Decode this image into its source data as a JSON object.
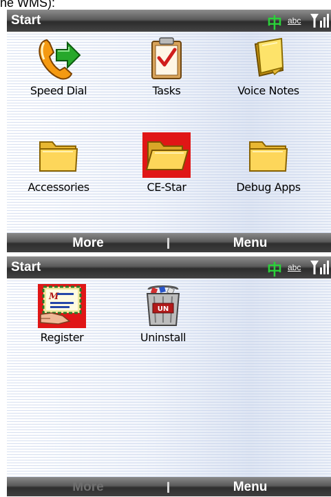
{
  "caption": "ne WMS):",
  "screens": [
    {
      "title": "Start",
      "status": {
        "ime": "中",
        "input_mode": "abc"
      },
      "items": [
        {
          "label": "Speed Dial",
          "icon": "speed-dial-phone-icon",
          "selected": false
        },
        {
          "label": "Tasks",
          "icon": "tasks-clipboard-icon",
          "selected": false
        },
        {
          "label": "Voice Notes",
          "icon": "voice-notes-icon",
          "selected": false
        },
        {
          "label": "Accessories",
          "icon": "folder-icon",
          "selected": false
        },
        {
          "label": "CE-Star",
          "icon": "folder-open-icon",
          "selected": true
        },
        {
          "label": "Debug Apps",
          "icon": "folder-icon",
          "selected": false
        }
      ],
      "softkeys": {
        "left": "More",
        "right": "Menu",
        "left_enabled": true
      }
    },
    {
      "title": "Start",
      "status": {
        "ime": "中",
        "input_mode": "abc"
      },
      "items": [
        {
          "label": "Register",
          "icon": "register-envelope-icon",
          "selected": true
        },
        {
          "label": "Uninstall",
          "icon": "uninstall-trash-icon",
          "selected": false
        }
      ],
      "softkeys": {
        "left": "More",
        "right": "Menu",
        "left_enabled": false
      }
    }
  ],
  "colors": {
    "selection": "#e01616",
    "ime_green": "#2bd13a",
    "bar_dark": "#2c2c2c"
  }
}
